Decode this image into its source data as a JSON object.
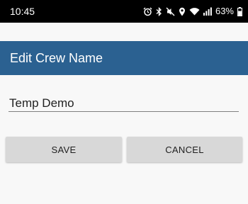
{
  "status_bar": {
    "time": "10:45",
    "battery_percent": "63%",
    "icons": [
      "alarm-icon",
      "bluetooth-icon",
      "mute-icon",
      "location-icon",
      "wifi-icon",
      "signal-icon",
      "battery-icon"
    ]
  },
  "app_bar": {
    "title": "Edit Crew Name",
    "color": "#2b6191"
  },
  "form": {
    "crew_name_value": "Temp Demo"
  },
  "actions": {
    "save_label": "SAVE",
    "cancel_label": "CANCEL"
  }
}
